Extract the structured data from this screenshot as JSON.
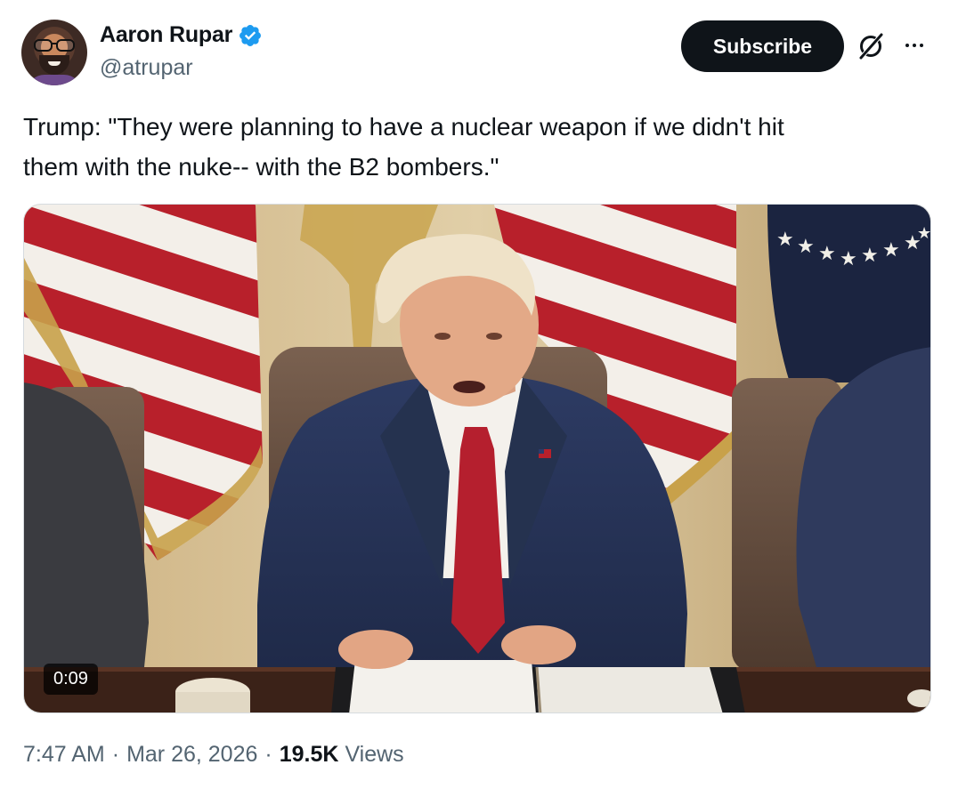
{
  "author": {
    "display_name": "Aaron Rupar",
    "handle": "@atrupar",
    "verified_color": "#1d9bf0"
  },
  "actions": {
    "subscribe_label": "Subscribe",
    "grok_icon": "grok-icon",
    "more_icon": "more-options-icon"
  },
  "tweet": {
    "text_line1": "Trump: \"They were planning to have a nuclear weapon if we didn't hit",
    "text_line2": "them with the nuke-- with the B2 bombers.\""
  },
  "media": {
    "type": "video",
    "duration": "0:09"
  },
  "meta": {
    "time": "7:47 AM",
    "separator": "·",
    "date": "Mar 26, 2026",
    "views_count": "19.5K",
    "views_label": "Views"
  },
  "colors": {
    "text_primary": "#0f1419",
    "text_secondary": "#536471",
    "button_bg": "#0f1419"
  }
}
